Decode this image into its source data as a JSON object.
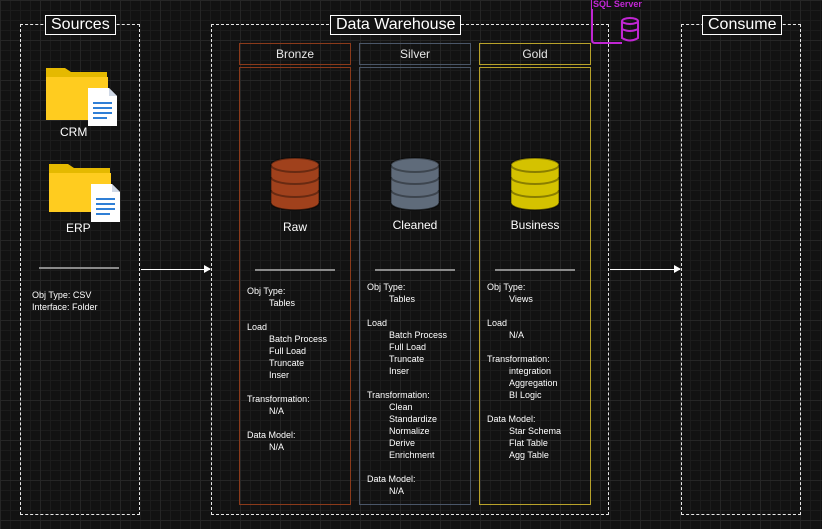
{
  "sections": {
    "sources": "Sources",
    "warehouse": "Data Warehouse",
    "consume": "Consume"
  },
  "sql_server": {
    "label": "SQL Server",
    "color": "#c026d3",
    "icon": "database-icon"
  },
  "sources": {
    "crm": {
      "label": "CRM",
      "icon": "folder-document-icon"
    },
    "erp": {
      "label": "ERP",
      "icon": "folder-document-icon"
    },
    "meta": {
      "obj_type": "Obj Type: CSV",
      "interface": "Interface: Folder"
    }
  },
  "layers": {
    "bronze": {
      "name": "Bronze",
      "label": "Raw",
      "color": "#8b3a1a",
      "db_color": "#a0411c",
      "icon": "database-icon",
      "obj_type_head": "Obj Type:",
      "obj_type": [
        "Tables"
      ],
      "load_head": "Load",
      "load": [
        "Batch Process",
        "Full Load",
        "Truncate",
        "Inser"
      ],
      "transformation_head": "Transformation:",
      "transformation": [
        "N/A"
      ],
      "model_head": "Data Model:",
      "model": [
        "N/A"
      ]
    },
    "silver": {
      "name": "Silver",
      "label": "Cleaned",
      "color": "#4a5668",
      "db_color": "#5f6b7a",
      "icon": "database-icon",
      "obj_type_head": "Obj Type:",
      "obj_type": [
        "Tables"
      ],
      "load_head": "Load",
      "load": [
        "Batch Process",
        "Full Load",
        "Truncate",
        "Inser"
      ],
      "transformation_head": "Transformation:",
      "transformation": [
        "Clean",
        "Standardize",
        "Normalize",
        "Derive",
        "Enrichment"
      ],
      "model_head": "Data Model:",
      "model": [
        "N/A"
      ]
    },
    "gold": {
      "name": "Gold",
      "label": "Business",
      "color": "#b8a22a",
      "db_color": "#d4c200",
      "icon": "database-icon",
      "obj_type_head": "Obj Type:",
      "obj_type": [
        "Views"
      ],
      "load_head": "Load",
      "load": [
        "N/A"
      ],
      "transformation_head": "Transformation:",
      "transformation": [
        "integration",
        "Aggregation",
        "BI Logic"
      ],
      "model_head": "Data Model:",
      "model": [
        "Star Schema",
        "Flat Table",
        "Agg Table"
      ]
    }
  }
}
